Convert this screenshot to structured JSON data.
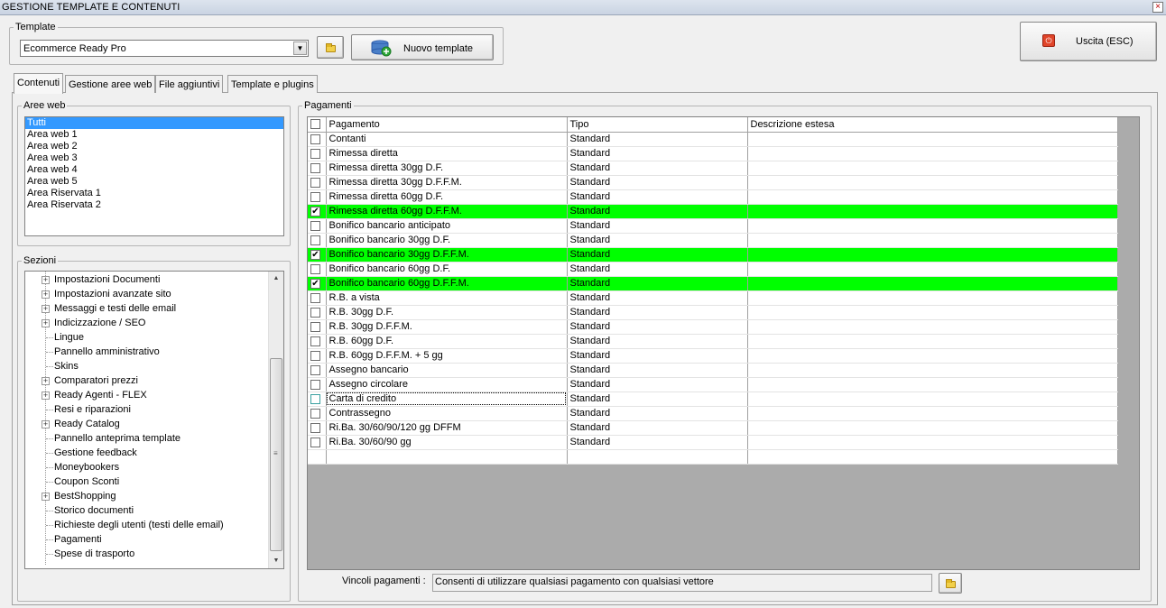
{
  "window": {
    "title": "GESTIONE TEMPLATE E CONTENUTI"
  },
  "template": {
    "legend": "Template",
    "selected": "Ecommerce Ready Pro",
    "new_button": "Nuovo template"
  },
  "exit_button": "Uscita (ESC)",
  "tabs": [
    {
      "label": "Contenuti",
      "active": true
    },
    {
      "label": "Gestione aree web",
      "active": false
    },
    {
      "label": "File aggiuntivi",
      "active": false
    },
    {
      "label": "Template e plugins",
      "active": false
    }
  ],
  "aree_web": {
    "legend": "Aree web",
    "items": [
      "Tutti",
      "Area web 1",
      "Area web 2",
      "Area web 3",
      "Area web 4",
      "Area web 5",
      "Area Riservata 1",
      "Area Riservata 2"
    ],
    "selected_index": 0
  },
  "sezioni": {
    "legend": "Sezioni",
    "items": [
      {
        "label": "Impostazioni Documenti",
        "expandable": true
      },
      {
        "label": "Impostazioni avanzate sito",
        "expandable": true
      },
      {
        "label": "Messaggi e testi delle email",
        "expandable": true
      },
      {
        "label": "Indicizzazione / SEO",
        "expandable": true
      },
      {
        "label": "Lingue",
        "expandable": false
      },
      {
        "label": "Pannello amministrativo",
        "expandable": false
      },
      {
        "label": "Skins",
        "expandable": false
      },
      {
        "label": "Comparatori prezzi",
        "expandable": true
      },
      {
        "label": "Ready Agenti - FLEX",
        "expandable": true
      },
      {
        "label": "Resi e riparazioni",
        "expandable": false
      },
      {
        "label": "Ready Catalog",
        "expandable": true
      },
      {
        "label": "Pannello anteprima template",
        "expandable": false
      },
      {
        "label": "Gestione feedback",
        "expandable": false
      },
      {
        "label": "Moneybookers",
        "expandable": false
      },
      {
        "label": "Coupon Sconti",
        "expandable": false
      },
      {
        "label": "BestShopping",
        "expandable": true
      },
      {
        "label": "Storico documenti",
        "expandable": false
      },
      {
        "label": "Richieste degli utenti (testi delle email)",
        "expandable": false
      },
      {
        "label": "Pagamenti",
        "expandable": false
      },
      {
        "label": "Spese di trasporto",
        "expandable": false
      }
    ]
  },
  "pagamenti": {
    "legend": "Pagamenti",
    "columns": [
      "Pagamento",
      "Tipo",
      "Descrizione estesa"
    ],
    "rows": [
      {
        "name": "Contanti",
        "tipo": "Standard",
        "desc": "",
        "checked": false,
        "highlight": false
      },
      {
        "name": "Rimessa diretta",
        "tipo": "Standard",
        "desc": "",
        "checked": false,
        "highlight": false
      },
      {
        "name": "Rimessa diretta 30gg D.F.",
        "tipo": "Standard",
        "desc": "",
        "checked": false,
        "highlight": false
      },
      {
        "name": "Rimessa diretta 30gg D.F.F.M.",
        "tipo": "Standard",
        "desc": "",
        "checked": false,
        "highlight": false
      },
      {
        "name": "Rimessa diretta 60gg D.F.",
        "tipo": "Standard",
        "desc": "",
        "checked": false,
        "highlight": false
      },
      {
        "name": "Rimessa diretta 60gg D.F.F.M.",
        "tipo": "Standard",
        "desc": "",
        "checked": true,
        "highlight": true
      },
      {
        "name": "Bonifico bancario anticipato",
        "tipo": "Standard",
        "desc": "",
        "checked": false,
        "highlight": false
      },
      {
        "name": "Bonifico bancario 30gg D.F.",
        "tipo": "Standard",
        "desc": "",
        "checked": false,
        "highlight": false
      },
      {
        "name": "Bonifico bancario 30gg D.F.F.M.",
        "tipo": "Standard",
        "desc": "",
        "checked": true,
        "highlight": true
      },
      {
        "name": "Bonifico bancario 60gg D.F.",
        "tipo": "Standard",
        "desc": "",
        "checked": false,
        "highlight": false
      },
      {
        "name": "Bonifico bancario 60gg D.F.F.M.",
        "tipo": "Standard",
        "desc": "",
        "checked": true,
        "highlight": true
      },
      {
        "name": "R.B. a vista",
        "tipo": "Standard",
        "desc": "",
        "checked": false,
        "highlight": false
      },
      {
        "name": "R.B. 30gg D.F.",
        "tipo": "Standard",
        "desc": "",
        "checked": false,
        "highlight": false
      },
      {
        "name": "R.B. 30gg D.F.F.M.",
        "tipo": "Standard",
        "desc": "",
        "checked": false,
        "highlight": false
      },
      {
        "name": "R.B. 60gg D.F.",
        "tipo": "Standard",
        "desc": "",
        "checked": false,
        "highlight": false
      },
      {
        "name": "R.B. 60gg D.F.F.M. + 5 gg",
        "tipo": "Standard",
        "desc": "",
        "checked": false,
        "highlight": false
      },
      {
        "name": "Assegno bancario",
        "tipo": "Standard",
        "desc": "",
        "checked": false,
        "highlight": false
      },
      {
        "name": "Assegno circolare",
        "tipo": "Standard",
        "desc": "",
        "checked": false,
        "highlight": false
      },
      {
        "name": "Carta di credito",
        "tipo": "Standard",
        "desc": "",
        "checked": false,
        "highlight": false,
        "focused": true
      },
      {
        "name": "Contrassegno",
        "tipo": "Standard",
        "desc": "",
        "checked": false,
        "highlight": false
      },
      {
        "name": "Ri.Ba. 30/60/90/120 gg DFFM",
        "tipo": "Standard",
        "desc": "",
        "checked": false,
        "highlight": false
      },
      {
        "name": "Ri.Ba. 30/60/90 gg",
        "tipo": "Standard",
        "desc": "",
        "checked": false,
        "highlight": false
      }
    ],
    "vincoli_label": "Vincoli pagamenti :",
    "vincoli_value": "Consenti di utilizzare qualsiasi pagamento con qualsiasi vettore"
  },
  "colors": {
    "highlight": "#00ff00",
    "selection": "#3399ff"
  }
}
